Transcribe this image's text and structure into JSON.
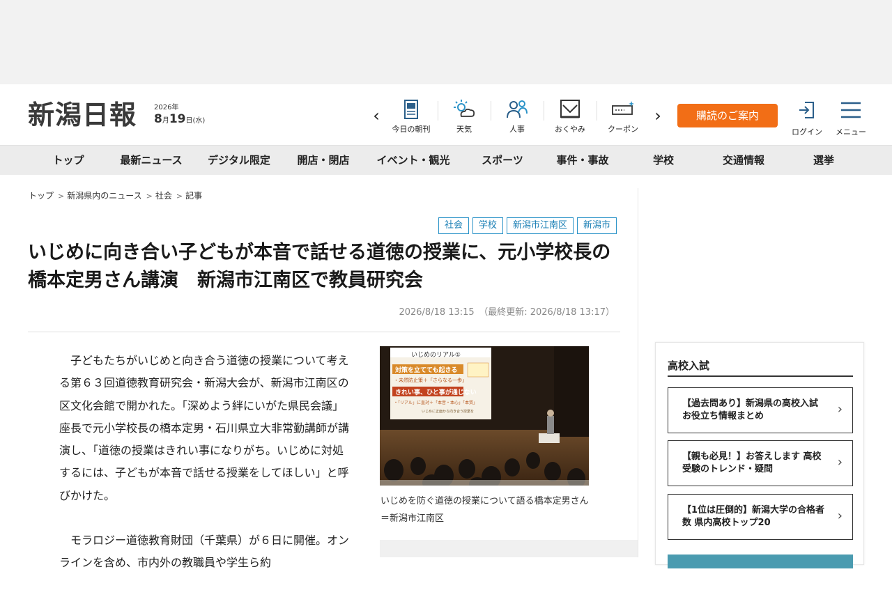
{
  "header": {
    "logo": "新潟日報",
    "date_year": "2026年",
    "date_month": "8",
    "date_day": "19",
    "date_weekday": "(水)",
    "nav_prev": "‹",
    "nav_next": "›",
    "nav_items": [
      {
        "label": "今日の朝刊",
        "icon": "newspaper-icon"
      },
      {
        "label": "天気",
        "icon": "weather-icon"
      },
      {
        "label": "人事",
        "icon": "people-icon"
      },
      {
        "label": "おくやみ",
        "icon": "condolence-icon"
      },
      {
        "label": "クーポン",
        "icon": "coupon-icon"
      }
    ],
    "subscribe_label": "購読のご案内",
    "login_label": "ログイン",
    "menu_label": "メニュー",
    "accent_color": "#f26e16"
  },
  "global_nav": [
    "トップ",
    "最新ニュース",
    "デジタル限定",
    "開店・閉店",
    "イベント・観光",
    "スポーツ",
    "事件・事故",
    "学校",
    "交通情報",
    "選挙"
  ],
  "breadcrumb": [
    "トップ",
    "新潟県内のニュース",
    "社会",
    "記事"
  ],
  "breadcrumb_sep": ">",
  "article": {
    "tags": [
      "社会",
      "学校",
      "新潟市江南区",
      "新潟市"
    ],
    "title": "いじめに向き合い子どもが本音で話せる道徳の授業に、元小学校長の橋本定男さん講演　新潟市江南区で教員研究会",
    "published": "2026/8/18 13:15",
    "updated": "（最終更新: 2026/8/18 13:17）",
    "paragraphs": [
      "子どもたちがいじめと向き合う道徳の授業について考える第６３回道徳教育研究会・新潟大会が、新潟市江南区の区文化会館で開かれた。「深めよう絆にいがた県民会議」座長で元小学校長の橋本定男・石川県立大非常勤講師が講演し、「道徳の授業はきれい事になりがち。いじめに対処するには、子どもが本音で話せる授業をしてほしい」と呼びかけた。",
      "モラロジー道徳教育財団（千葉県）が６日に開催。オンラインを含め、市内外の教職員や学生ら約"
    ],
    "photo": {
      "slide_title": "いじめのリアル①",
      "slide_line1": "対策を立てても起きる",
      "slide_line2": "・未然防止策＋「さらなる一歩」",
      "slide_line3": "きれい事、ひと事が通じない",
      "slide_line4": "・「リアル」に直対＋「本音・本心」「本質」",
      "slide_line5": "いじめに正面から向き合う授業を",
      "caption": "いじめを防ぐ道徳の授業について語る橋本定男さん＝新潟市江南区"
    }
  },
  "sidebar": {
    "heading": "高校入試",
    "cards": [
      "【過去問あり】新潟県の高校入試 お役立ち情報まとめ",
      "【親も必見！】お答えします 高校受験のトレンド・疑問",
      "【1位は圧倒的】新潟大学の合格者数 県内高校トップ20"
    ],
    "chevron": "›"
  }
}
